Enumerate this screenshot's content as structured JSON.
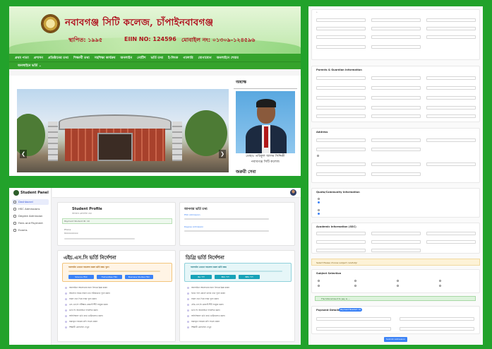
{
  "college": {
    "title": "নবাবগঞ্জ সিটি কলেজ, চাঁপাইনবাবগঞ্জ",
    "established": "স্থাপিত: ১৯৯৫",
    "eiin": "EIIN NO: 124596",
    "mobile": "মোবাইল নং: ০১৩০৯-১২৪৫৯৬",
    "nav": [
      "প্রথম পাতা",
      "প্রশাসন",
      "প্রতিষ্ঠানের তথ্য",
      "শিক্ষার্থী তথ্য",
      "সহশিক্ষা কার্যক্রম",
      "অনলাইন",
      "নোটিশ",
      "ভর্তি তথ্য",
      "ই-লিংক",
      "গ্যালারি",
      "যোগাযোগ",
      "অনলাইনে শেয়ার"
    ],
    "nav2": "অনলাইনে ভর্তি ⌄",
    "side_heading": "অধ্যক্ষ",
    "principal_caption": [
      "মোহাঃ তরিকুল আলম সিদ্দিকী",
      "নবাবগঞ্জ সিটি কলেজ"
    ],
    "side_heading2": "জরুরী সেবা",
    "slider_prev": "❮",
    "slider_next": "❯"
  },
  "form": {
    "sections": [
      {
        "title": "Parents & Guardian Information"
      },
      {
        "title": "Address"
      },
      {
        "title": "Quota/Community Information"
      },
      {
        "title": "Academic Information (SSC)"
      }
    ],
    "warn": "Select Please choose subject carefully!",
    "subject_selection": "Subject Selection",
    "ok": "The total amount to pay is ...",
    "payment": "Payment Details",
    "payment_pill": "Payment Needed: 10",
    "submit": "Submit Admission"
  },
  "portal": {
    "brand": "Student Panel",
    "menu": [
      {
        "label": "Dashboard",
        "active": true
      },
      {
        "label": "HSC Admissions",
        "active": false
      },
      {
        "label": "Degree Admission",
        "active": false
      },
      {
        "label": "Fees and Payment",
        "active": false
      },
      {
        "label": "Exams",
        "active": false
      }
    ],
    "profile_title": "Student Profile",
    "profile_sub": "আপনার প্রোফাইল তথ্য",
    "payment_id": "Payment Student ID: 10",
    "phone_label": "Phone",
    "phone_value": "0xxxxxxxxxx",
    "info_title": "আপনার ভর্তি তথ্য",
    "info_hsc": "HSC Admission",
    "info_degree": "Degree Admission",
    "hsc_heading": "এইচ.এস.সি ভর্তি নির্দেশনা",
    "degree_heading": "ডিগ্রি ভর্তি নির্দেশনা",
    "hsc_alert": "অনলাইন এখানে আবেদন করুন ভর্তি ফরম পূরণ",
    "degree_alert": "অনলাইন এখানে আবেদন করুন ভর্তি ফরম",
    "btn_hsc": [
      "Science HSC",
      "Humanities HSC",
      "Business Studies HSC"
    ],
    "btn_degree": [
      "BA পাস",
      "BSS পাস",
      "BBS পাস"
    ],
    "hsc_steps": [
      "অনলাইনে আবেদনের জন্য লিংকে ক্লিক করুন",
      "আবেদন ফরমে সকল তথ্য সঠিকভাবে পূরণ করুন",
      "সকল তথ্য দিয়ে ফরম পূরণ করুন",
      "এস.এস.সি পরীক্ষার রেজাল্ট শীট সংযুক্ত করুন",
      "ভর্তি ফি অনলাইনে পরিশোধ করুন",
      "অফিসিয়াল ভর্তি কার্ড ডাউনলোড করুন",
      "জমাকৃত ফরমের কপি সংগ্রহ করুন",
      "শিক্ষার্থী প্রোফাইল দেখুন"
    ],
    "degree_steps": [
      "অনলাইনে আবেদনের জন্য লিংকে ক্লিক করুন",
      "ডিগ্রি পাস কোর্সে ভর্তির তথ্য পূরণ করুন",
      "সকল তথ্য দিয়ে ফরম পূরণ করুন",
      "এইচ.এস.সি রেজাল্ট শীট সংযুক্ত করুন",
      "ভর্তি ফি অনলাইনে পরিশোধ করুন",
      "অফিসিয়াল ভর্তি কার্ড ডাউনলোড করুন",
      "জমাকৃত ফরমের কপি সংগ্রহ করুন",
      "শিক্ষার্থী প্রোফাইল দেখুন"
    ]
  },
  "colors": {
    "bg": "#22a22b",
    "nav": "#35a32c",
    "title_red": "#b0111e",
    "accent_blue": "#3b82f6"
  }
}
